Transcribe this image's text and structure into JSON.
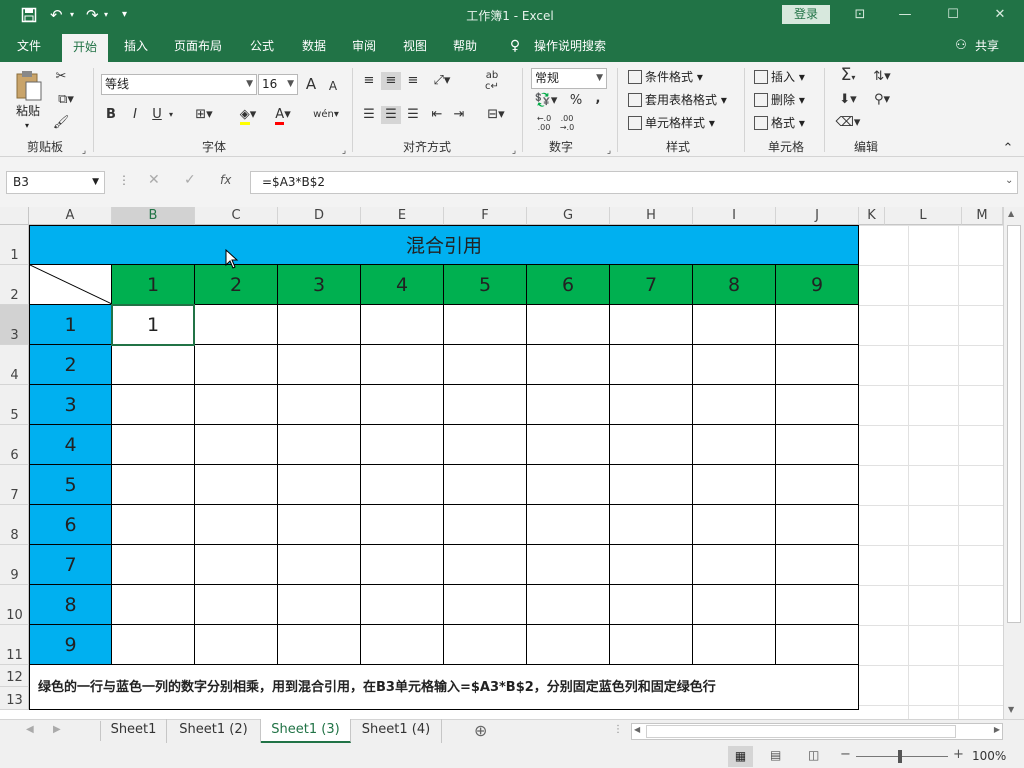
{
  "titlebar": {
    "title": "工作簿1  -  Excel",
    "login": "登录",
    "save_icon": "save-icon",
    "undo_icon": "undo-icon",
    "redo_icon": "redo-icon"
  },
  "menu": {
    "tabs": [
      "文件",
      "开始",
      "插入",
      "页面布局",
      "公式",
      "数据",
      "审阅",
      "视图",
      "帮助"
    ],
    "tell_me": "操作说明搜索",
    "share": "共享"
  },
  "ribbon": {
    "clipboard": {
      "paste": "粘贴",
      "label": "剪贴板"
    },
    "font": {
      "name": "等线",
      "size": "16",
      "label": "字体",
      "bold": "B",
      "italic": "I",
      "underline": "U",
      "font_color_glyph": "A",
      "grow": "A",
      "shrink": "A",
      "phonetic": "wén"
    },
    "alignment": {
      "label": "对齐方式"
    },
    "number": {
      "format": "常规",
      "label": "数字",
      "percent": "%",
      "comma": ",",
      "inc_decimal": "←.0 .00",
      "dec_decimal": ".00 →.0"
    },
    "styles": {
      "conditional": "条件格式",
      "table": "套用表格格式",
      "cell": "单元格样式",
      "label": "样式"
    },
    "cells": {
      "insert": "插入",
      "delete": "删除",
      "format": "格式",
      "label": "单元格"
    },
    "editing": {
      "sum": "Σ",
      "label": "编辑"
    }
  },
  "formula_bar": {
    "name_box": "B3",
    "formula": "=$A3*B$2",
    "fx": "fx"
  },
  "sheet": {
    "columns": [
      "A",
      "B",
      "C",
      "D",
      "E",
      "F",
      "G",
      "H",
      "I",
      "J",
      "K",
      "L",
      "M"
    ],
    "rows": [
      "1",
      "2",
      "3",
      "4",
      "5",
      "6",
      "7",
      "8",
      "9",
      "10",
      "11",
      "12",
      "13"
    ],
    "title": "混合引用",
    "header_row": [
      "1",
      "2",
      "3",
      "4",
      "5",
      "6",
      "7",
      "8",
      "9"
    ],
    "header_col": [
      "1",
      "2",
      "3",
      "4",
      "5",
      "6",
      "7",
      "8",
      "9"
    ],
    "b3_value": "1",
    "note": "绿色的一行与蓝色一列的数字分别相乘，用到混合引用，在B3单元格输入=$A3*B$2，分别固定蓝色列和固定绿色行",
    "colors": {
      "blue": "#00B0F0",
      "green": "#00B050"
    }
  },
  "sheet_tabs": [
    "Sheet1",
    "Sheet1 (2)",
    "Sheet1 (3)",
    "Sheet1 (4)"
  ],
  "active_sheet_index": 2,
  "status": {
    "zoom": "100%"
  }
}
